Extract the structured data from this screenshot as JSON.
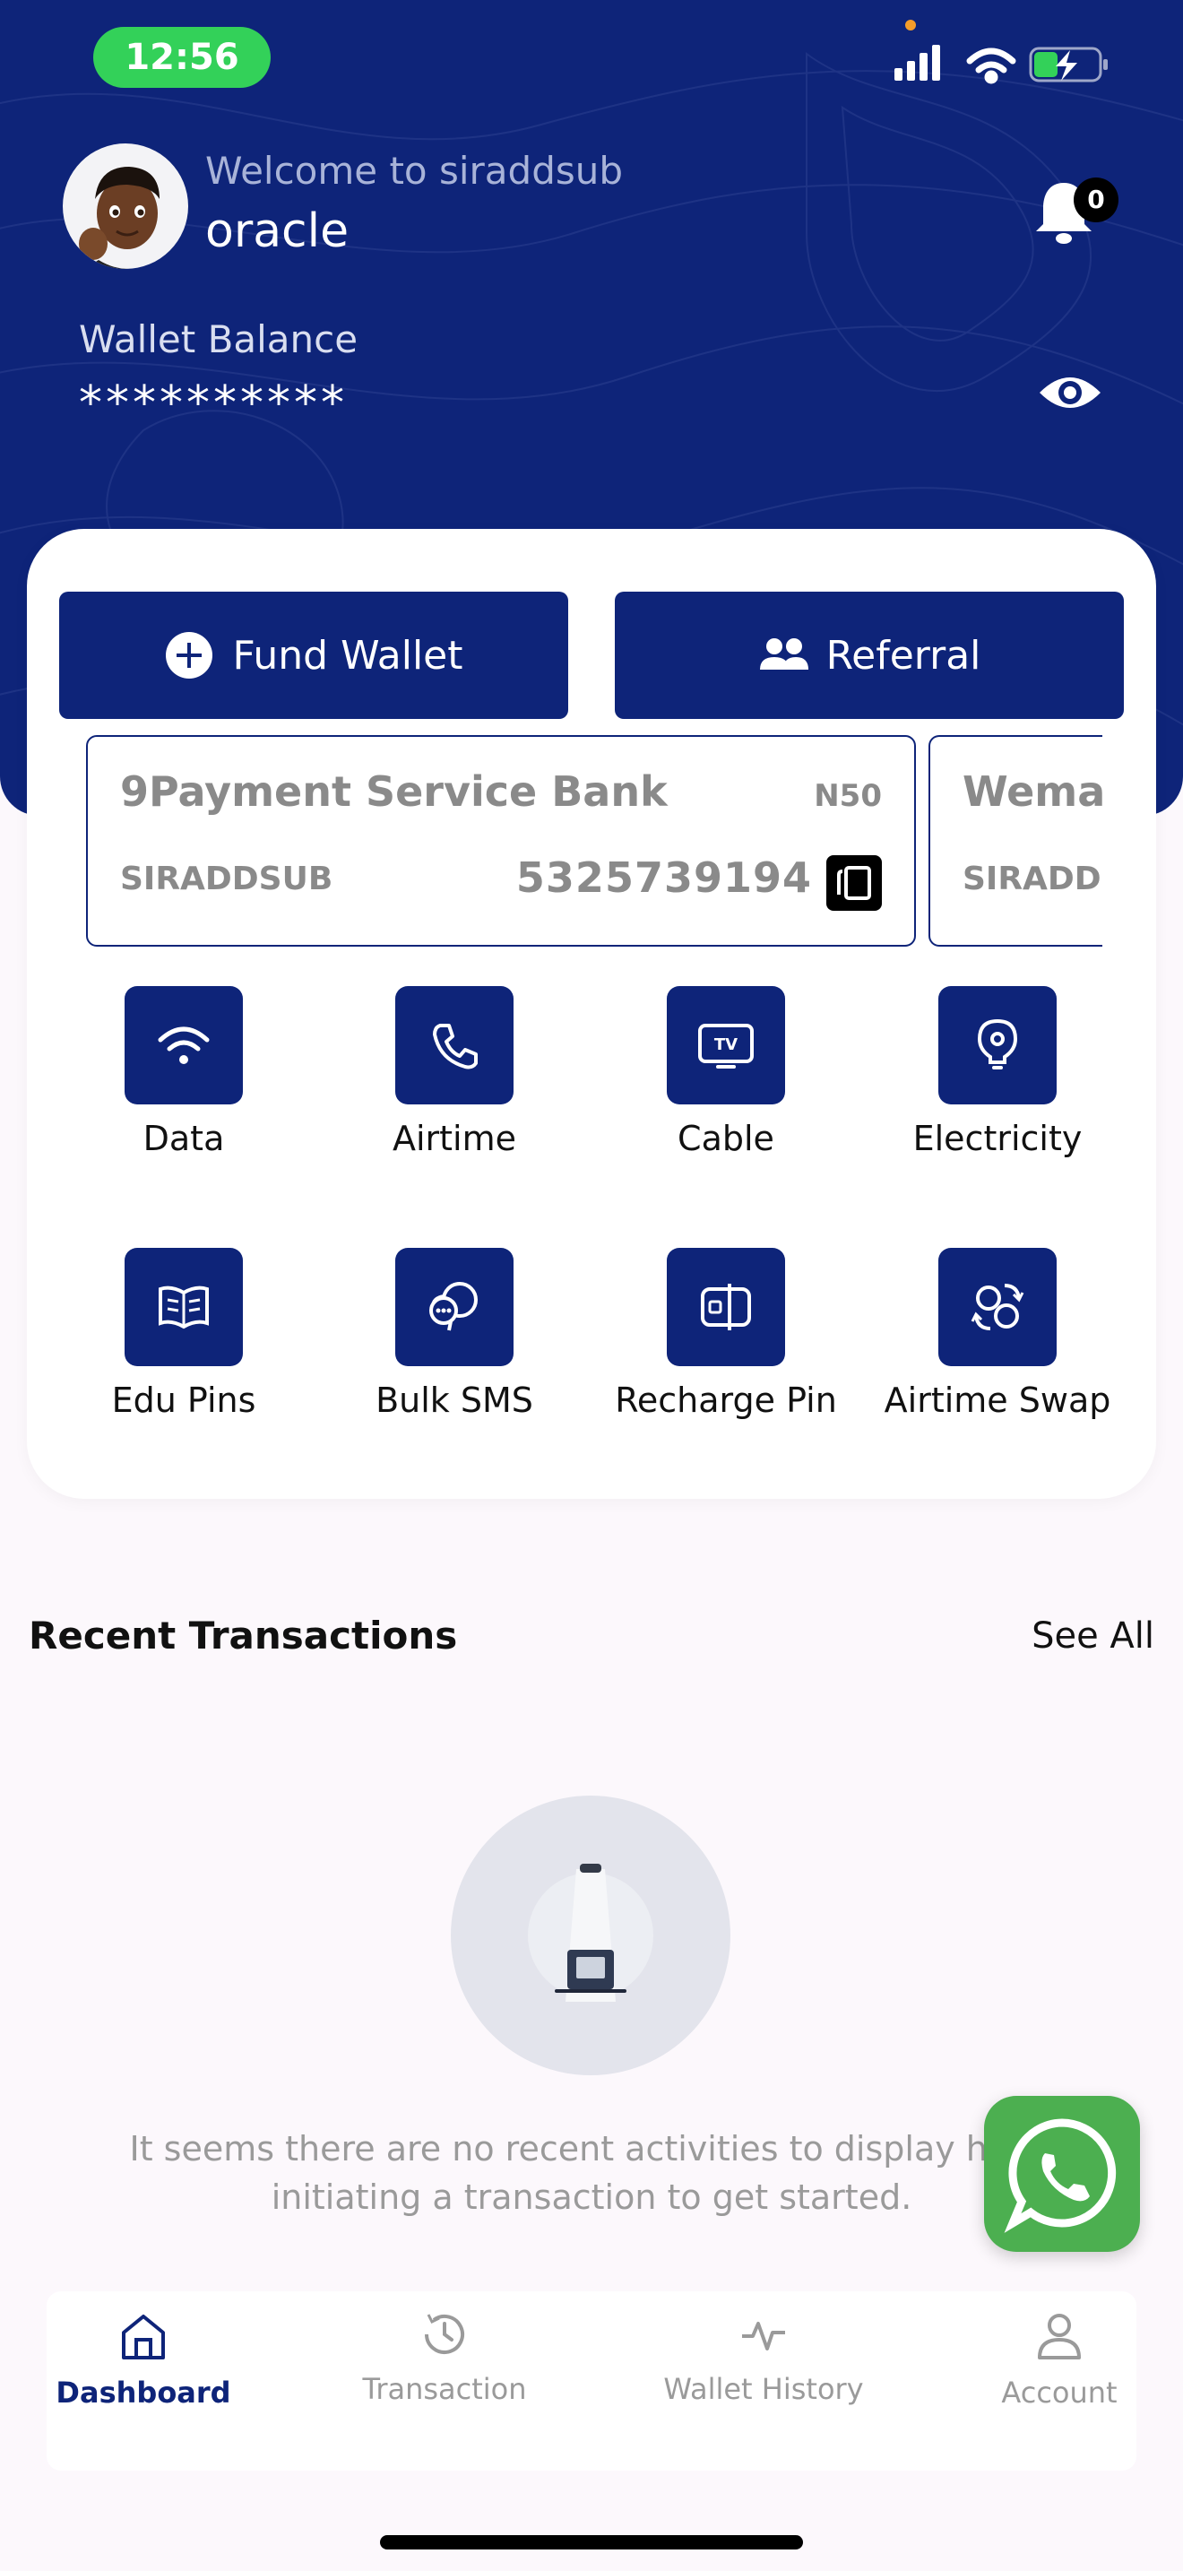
{
  "status": {
    "time": "12:56"
  },
  "header": {
    "welcome": "Welcome to siraddsub",
    "username": "oracle",
    "notifications": "0",
    "wallet_label": "Wallet Balance",
    "wallet_balance": "**********"
  },
  "actions": {
    "fund_wallet": "Fund Wallet",
    "referral": "Referral"
  },
  "banks": [
    {
      "name": "9Payment Service Bank",
      "fee": "N50",
      "account_name": "SIRADDSUB",
      "account_number": "5325739194"
    },
    {
      "name": "Wema",
      "account_name": "SIRADD"
    }
  ],
  "services": [
    {
      "label": "Data",
      "icon": "wifi-icon"
    },
    {
      "label": "Airtime",
      "icon": "phone-icon"
    },
    {
      "label": "Cable",
      "icon": "tv-icon"
    },
    {
      "label": "Electricity",
      "icon": "bulb-icon"
    },
    {
      "label": "Edu Pins",
      "icon": "book-icon"
    },
    {
      "label": "Bulk SMS",
      "icon": "chat-icon"
    },
    {
      "label": "Recharge Pin",
      "icon": "card-icon"
    },
    {
      "label": "Airtime Swap",
      "icon": "swap-icon"
    }
  ],
  "recent": {
    "title": "Recent Transactions",
    "see_all": "See All",
    "empty_line1": "It seems there are no recent activities to display here.",
    "empty_line2": "initiating a transaction to get started."
  },
  "nav": [
    {
      "label": "Dashboard",
      "active": true
    },
    {
      "label": "Transaction"
    },
    {
      "label": "Wallet History"
    },
    {
      "label": "Account"
    }
  ],
  "colors": {
    "primary": "#0e2479",
    "whatsapp": "#4caf50",
    "status_green": "#33d159"
  }
}
